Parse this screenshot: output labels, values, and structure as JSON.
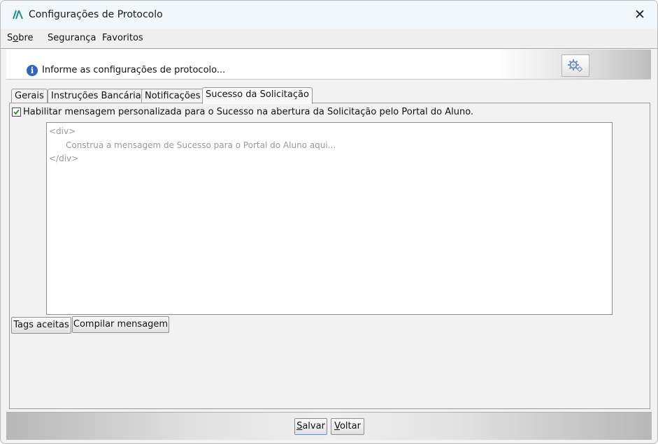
{
  "window": {
    "title": "Configurações de Protocolo",
    "close_glyph": "✕"
  },
  "menu": [
    {
      "prefix": "S",
      "accel": "o",
      "rest": "bre"
    },
    {
      "prefix": "",
      "accel": "",
      "rest": "Segurança"
    },
    {
      "prefix": "",
      "accel": "",
      "rest": "Favoritos"
    }
  ],
  "banner": {
    "info_glyph": "i",
    "text": "Informe as configurações de protocolo..."
  },
  "tabs": [
    {
      "label": "Gerais"
    },
    {
      "label": "Instruções Bancárias"
    },
    {
      "label": "Notificações"
    },
    {
      "label": "Sucesso da Solicitação",
      "active": true
    }
  ],
  "panel": {
    "checkbox_checked": true,
    "checkbox_label": "Habilitar mensagem personalizada para o Sucesso na abertura da Solicitação pelo Portal do Aluno.",
    "editor_lines": [
      "<div>",
      "Construa a mensagem de Sucesso para o Portal do Aluno aqui...",
      "</div>"
    ],
    "buttons": {
      "tags": "Tags aceitas",
      "compile": "Compilar mensagem"
    }
  },
  "footer": {
    "save": {
      "accel": "S",
      "rest": "alvar"
    },
    "back": {
      "accel": "V",
      "rest": "oltar"
    }
  },
  "colors": {
    "accent": "#2f63c9",
    "checkmark": "#2e8b2e",
    "titlebar_bg": "#f2f7fb"
  }
}
